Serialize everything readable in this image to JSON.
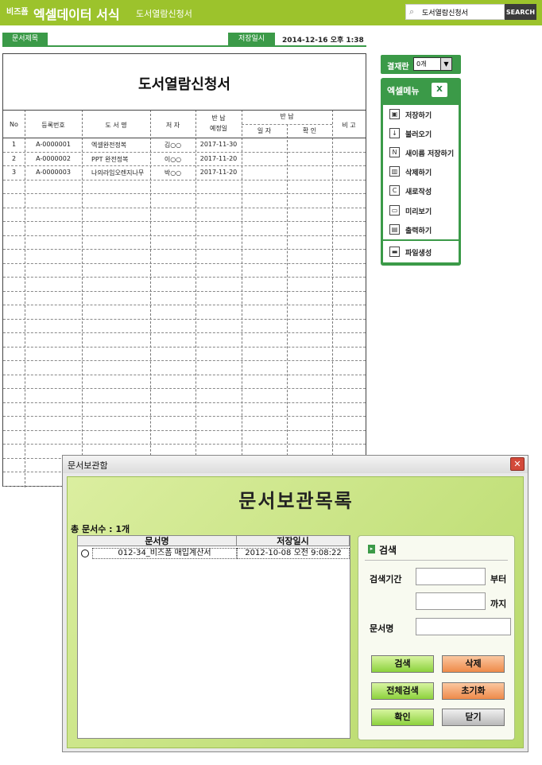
{
  "header": {
    "logo_small": "비즈폼",
    "app_title": "엑셀데이터 서식",
    "sub_title": "도서열람신청서",
    "search_value": "도서열람신청서",
    "search_button": "SEARCH"
  },
  "docinfo": {
    "title_tag": "문서제목",
    "save_date_tag": "저장일시",
    "save_date_value": "2014-12-16  오후 1:38"
  },
  "form": {
    "title": "도서열람신청서",
    "headers": {
      "no": "No",
      "reg_no": "등록번호",
      "book_name": "도 서 명",
      "author": "저 자",
      "return_due_1": "반 납",
      "return_due_2": "예정일",
      "return": "반 납",
      "return_date": "일 자",
      "return_confirm": "확 인",
      "remark": "비 고"
    },
    "rows": [
      {
        "no": "1",
        "reg_no": "A-0000001",
        "book": "엑셀완전정복",
        "author": "김○○",
        "due": "2017-11-30"
      },
      {
        "no": "2",
        "reg_no": "A-0000002",
        "book": "PPT 완전정복",
        "author": "이○○",
        "due": "2017-11-20"
      },
      {
        "no": "3",
        "reg_no": "A-0000003",
        "book": "나의라임오렌지나무",
        "author": "박○○",
        "due": "2017-11-20"
      }
    ]
  },
  "right_panel": {
    "approval_label": "결재란",
    "approval_value": "0개",
    "menu_title": "엑셀메뉴",
    "excel_icon_glyph": "X",
    "items": [
      {
        "label": "저장하기",
        "icon": "save-icon",
        "glyph": "▣"
      },
      {
        "label": "불러오기",
        "icon": "open-icon",
        "glyph": "↓"
      },
      {
        "label": "새이름 저장하기",
        "icon": "save-as-icon",
        "glyph": "N"
      },
      {
        "label": "삭제하기",
        "icon": "trash-icon",
        "glyph": "▥"
      },
      {
        "label": "새로작성",
        "icon": "new-doc-icon",
        "glyph": "C"
      },
      {
        "label": "미리보기",
        "icon": "preview-icon",
        "glyph": "▭"
      },
      {
        "label": "출력하기",
        "icon": "print-icon",
        "glyph": "▤"
      },
      {
        "label": "파일생성",
        "icon": "folder-icon",
        "glyph": "▬"
      }
    ]
  },
  "dialog": {
    "title": "문서보관함",
    "close_glyph": "✕",
    "heading": "문서보관목록",
    "count_label": "총 문서수 : 1개",
    "col_name": "문서명",
    "col_date": "저장일시",
    "row_name": "012-34_비즈폼 매입계산서",
    "row_date": "2012-10-08 오전 9:08:22",
    "search_title": "검색",
    "period_label": "검색기간",
    "from_label": "부터",
    "to_label": "까지",
    "docname_label": "문서명",
    "buttons": {
      "search": "검색",
      "delete": "삭제",
      "search_all": "전체검색",
      "reset": "초기화",
      "ok": "확인",
      "close": "닫기"
    }
  }
}
